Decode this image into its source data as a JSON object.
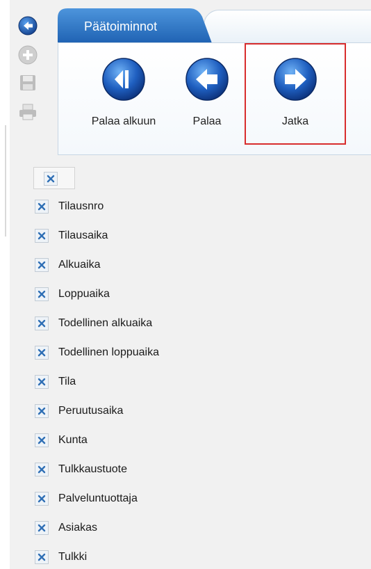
{
  "toolbar": {
    "icons": [
      "back-circle-icon",
      "add-icon",
      "save-icon",
      "print-icon"
    ]
  },
  "tabs": [
    {
      "label": "Päätoiminnot",
      "active": true
    },
    {
      "label": "",
      "active": false
    }
  ],
  "ribbon": {
    "buttons": [
      {
        "label": "Palaa alkuun",
        "icon": "skip-to-start-icon"
      },
      {
        "label": "Palaa",
        "icon": "arrow-left-icon"
      },
      {
        "label": "Jatka",
        "icon": "arrow-right-icon",
        "highlighted": true
      }
    ]
  },
  "columns": {
    "select_all_checked": true,
    "items": [
      {
        "label": "Tilausnro",
        "checked": true
      },
      {
        "label": "Tilausaika",
        "checked": true
      },
      {
        "label": "Alkuaika",
        "checked": true
      },
      {
        "label": "Loppuaika",
        "checked": true
      },
      {
        "label": "Todellinen alkuaika",
        "checked": true
      },
      {
        "label": "Todellinen loppuaika",
        "checked": true
      },
      {
        "label": "Tila",
        "checked": true
      },
      {
        "label": "Peruutusaika",
        "checked": true
      },
      {
        "label": "Kunta",
        "checked": true
      },
      {
        "label": "Tulkkaustuote",
        "checked": true
      },
      {
        "label": "Palveluntuottaja",
        "checked": true
      },
      {
        "label": "Asiakas",
        "checked": true
      },
      {
        "label": "Tulkki",
        "checked": true
      }
    ]
  },
  "colors": {
    "accent_blue": "#2a73c8",
    "highlight_red": "#d82c2c",
    "checkbox_x": "#2f6fb5"
  }
}
